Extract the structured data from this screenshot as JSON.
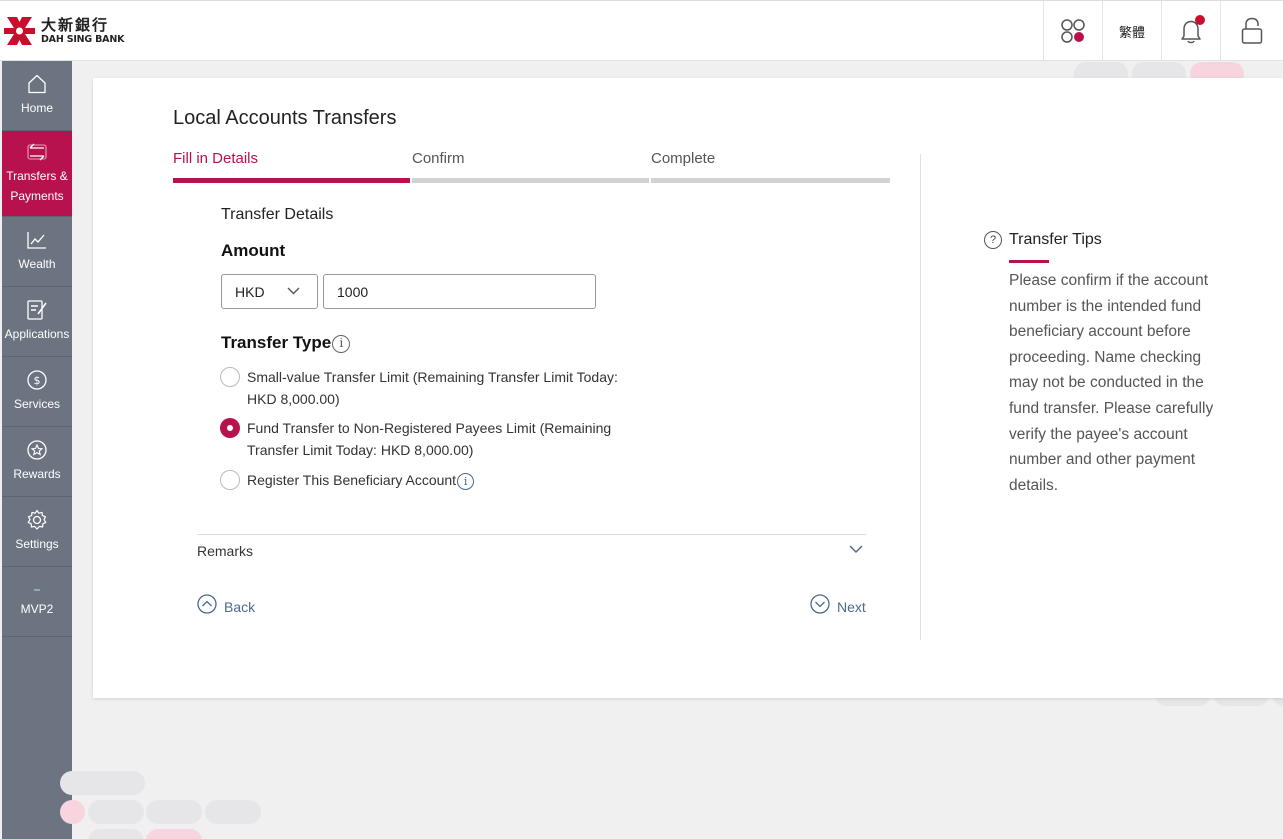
{
  "header": {
    "logo_cn": "大新銀行",
    "logo_en": "DAH SING BANK",
    "lang_label": "繁體",
    "icons": [
      "apps-icon",
      "bell-icon",
      "lock-icon"
    ]
  },
  "sidebar": {
    "items": [
      {
        "label": "Home",
        "icon": "home-icon"
      },
      {
        "label": "Transfers & Payments",
        "icon": "transfer-icon"
      },
      {
        "label": "Wealth",
        "icon": "chart-icon"
      },
      {
        "label": "Applications",
        "icon": "form-icon"
      },
      {
        "label": "Services",
        "icon": "dollar-icon"
      },
      {
        "label": "Rewards",
        "icon": "star-icon"
      },
      {
        "label": "Settings",
        "icon": "gear-icon"
      },
      {
        "label": "MVP2",
        "icon": "dash-icon"
      }
    ]
  },
  "main": {
    "title": "Local Accounts Transfers",
    "steps": [
      "Fill in Details",
      "Confirm",
      "Complete"
    ],
    "section_title": "Transfer Details",
    "amount_label": "Amount",
    "currency": "HKD",
    "amount_value": "1000",
    "transfer_type_label": "Transfer Type",
    "options": [
      {
        "label": "Small-value Transfer Limit (Remaining Transfer Limit Today: HKD 8,000.00)",
        "checked": false
      },
      {
        "label": "Fund Transfer to Non-Registered Payees Limit (Remaining Transfer Limit Today: HKD 8,000.00)",
        "checked": true
      }
    ],
    "register_label": "Register This Beneficiary Account",
    "remarks_label": "Remarks",
    "back_label": "Back",
    "next_label": "Next"
  },
  "tips": {
    "title": "Transfer Tips",
    "body": "Please confirm if the account number is the intended fund beneficiary account before proceeding. Name checking may not be conducted in the fund transfer. Please carefully verify the payee's account number and other payment details."
  },
  "colors": {
    "brand": "#b8124e",
    "sidebar": "#6c7482",
    "link": "#4a6b8a"
  }
}
